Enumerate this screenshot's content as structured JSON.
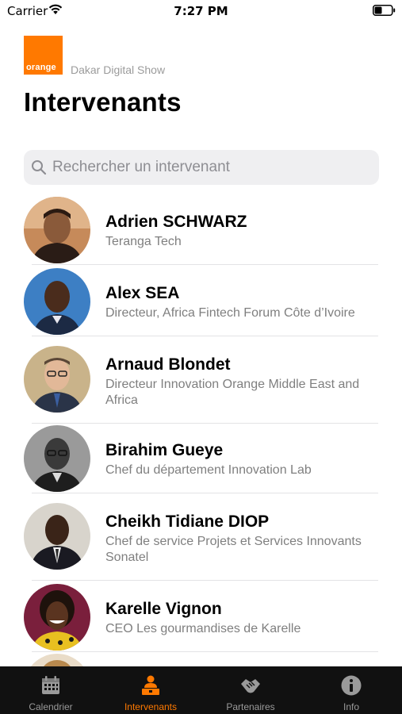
{
  "status_bar": {
    "carrier": "Carrier",
    "time": "7:27 PM"
  },
  "header": {
    "logo_text": "orange",
    "subtitle": "Dakar Digital Show",
    "title": "Intervenants"
  },
  "search": {
    "placeholder": "Rechercher un intervenant",
    "value": ""
  },
  "speakers": [
    {
      "name": "Adrien SCHWARZ",
      "role": "Teranga Tech"
    },
    {
      "name": "Alex SEA",
      "role": "Directeur, Africa Fintech Forum Côte d’Ivoire"
    },
    {
      "name": "Arnaud Blondet",
      "role": "Directeur Innovation Orange Middle East and Africa"
    },
    {
      "name": "Birahim Gueye",
      "role": "Chef du département Innovation Lab"
    },
    {
      "name": "Cheikh Tidiane DIOP",
      "role": "Chef de service Projets et Services Innovants Sonatel"
    },
    {
      "name": "Karelle Vignon",
      "role": "CEO Les gourmandises de Karelle"
    }
  ],
  "tab_bar": {
    "active_index": 1,
    "items": [
      {
        "label": "Calendrier",
        "icon": "calendar-icon"
      },
      {
        "label": "Intervenants",
        "icon": "speaker-icon"
      },
      {
        "label": "Partenaires",
        "icon": "handshake-icon"
      },
      {
        "label": "Info",
        "icon": "info-icon"
      }
    ]
  },
  "colors": {
    "brand_orange": "#ff7900",
    "tab_bar_bg": "#111111",
    "tab_inactive": "#9a9a9a",
    "secondary_text": "#7f7f7f"
  }
}
